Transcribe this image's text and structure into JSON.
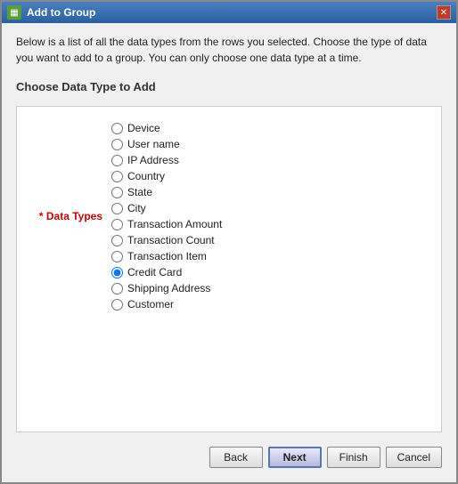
{
  "window": {
    "title": "Add to Group",
    "close_icon": "✕"
  },
  "description": "Below is a list of all the data types from the rows you selected. Choose the type of data you want to add to a group. You can only choose one data type at a time.",
  "section": {
    "title": "Choose Data Type to Add"
  },
  "form": {
    "field_label": "* Data Types",
    "options": [
      {
        "id": "opt_device",
        "label": "Device",
        "selected": false
      },
      {
        "id": "opt_username",
        "label": "User name",
        "selected": false
      },
      {
        "id": "opt_ipaddress",
        "label": "IP Address",
        "selected": false
      },
      {
        "id": "opt_country",
        "label": "Country",
        "selected": false
      },
      {
        "id": "opt_state",
        "label": "State",
        "selected": false
      },
      {
        "id": "opt_city",
        "label": "City",
        "selected": false
      },
      {
        "id": "opt_txamount",
        "label": "Transaction Amount",
        "selected": false
      },
      {
        "id": "opt_txcount",
        "label": "Transaction Count",
        "selected": false
      },
      {
        "id": "opt_txitem",
        "label": "Transaction Item",
        "selected": false
      },
      {
        "id": "opt_creditcard",
        "label": "Credit Card",
        "selected": true
      },
      {
        "id": "opt_shipping",
        "label": "Shipping Address",
        "selected": false
      },
      {
        "id": "opt_customer",
        "label": "Customer",
        "selected": false
      }
    ]
  },
  "buttons": {
    "back": "Back",
    "next": "Next",
    "finish": "Finish",
    "cancel": "Cancel"
  }
}
